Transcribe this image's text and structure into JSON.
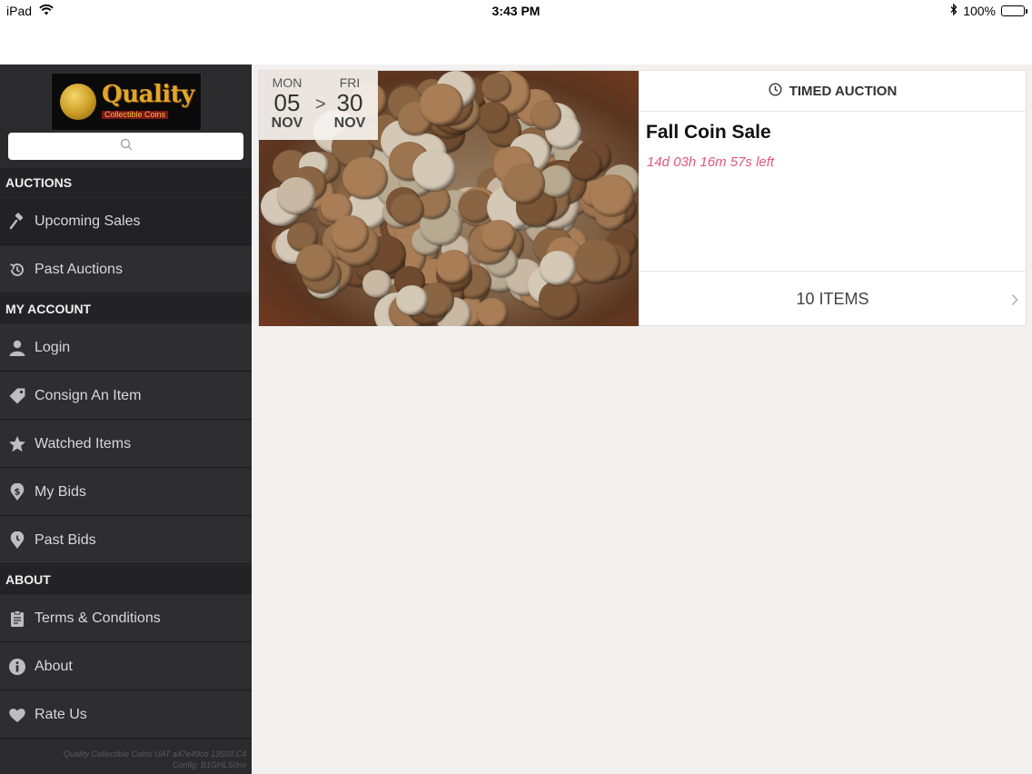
{
  "status_bar": {
    "device": "iPad",
    "time": "3:43 PM",
    "battery": "100%",
    "battery_level": 1.0
  },
  "sidebar": {
    "logo": {
      "text": "Quality",
      "subtext": "Collectible Coins"
    },
    "search": {
      "placeholder": ""
    },
    "sections": [
      {
        "header": "AUCTIONS"
      },
      {
        "header": "MY ACCOUNT"
      },
      {
        "header": "ABOUT"
      }
    ],
    "items": [
      {
        "label": "Upcoming Sales",
        "icon": "gavel-icon"
      },
      {
        "label": "Past Auctions",
        "icon": "history-icon"
      },
      {
        "label": "Login",
        "icon": "user-icon"
      },
      {
        "label": "Consign An Item",
        "icon": "tag-icon"
      },
      {
        "label": "Watched Items",
        "icon": "star-icon"
      },
      {
        "label": "My Bids",
        "icon": "dollar-icon"
      },
      {
        "label": "Past Bids",
        "icon": "clock-icon"
      },
      {
        "label": "Terms & Conditions",
        "icon": "clipboard-icon"
      },
      {
        "label": "About",
        "icon": "info-icon"
      },
      {
        "label": "Rate Us",
        "icon": "heart-icon"
      }
    ],
    "footer_line1": "Quality Collectible Coins UAT a47e49cb 13503.C4",
    "footer_line2": "Config: B1GHLS0nx"
  },
  "auction": {
    "start": {
      "dow": "MON",
      "day": "05",
      "month": "NOV"
    },
    "separator": ">",
    "end": {
      "dow": "FRI",
      "day": "30",
      "month": "NOV"
    },
    "type": "TIMED AUCTION",
    "title": "Fall Coin Sale",
    "countdown": "14d 03h 16m 57s left",
    "items": "10 ITEMS"
  },
  "colors": {
    "sidebar_bg": "#2b2b2d",
    "main_bg": "#f2f1f0",
    "countdown": "#e0587a"
  }
}
